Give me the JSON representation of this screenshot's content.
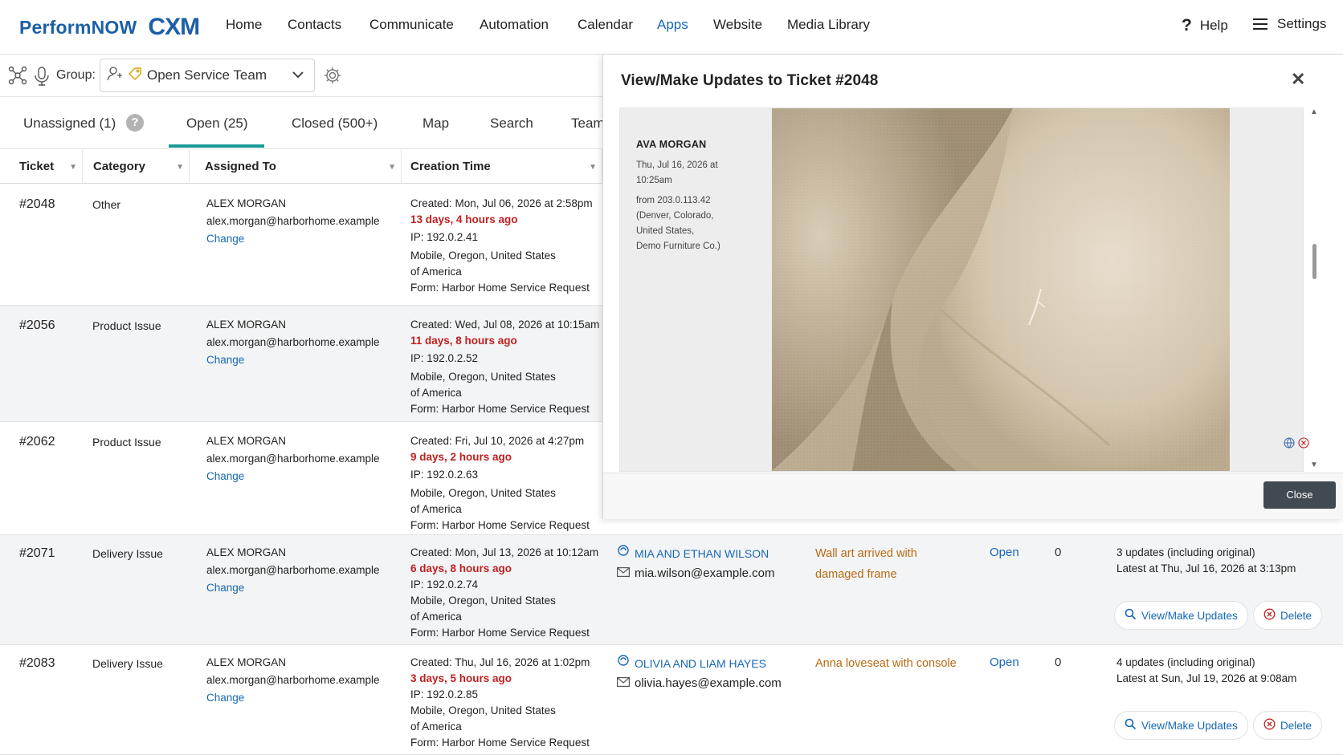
{
  "nav": {
    "logo_text": "PerformNOW",
    "logo_mark": "CXM",
    "items": [
      "Home",
      "Contacts",
      "Communicate",
      "Automation",
      "Calendar",
      "Apps",
      "Website",
      "Media Library"
    ],
    "active": "Apps",
    "help": "Help",
    "help_icon": "?",
    "settings": "Settings"
  },
  "toolbar": {
    "group_label": "Group:",
    "group_value": "Open Service Team"
  },
  "tabs": {
    "unassigned": "Unassigned (1)",
    "open": "Open (25)",
    "closed": "Closed (500+)",
    "map": "Map",
    "search": "Search",
    "team": "Team",
    "help_bubble": "?"
  },
  "columns": {
    "ticket": "Ticket",
    "category": "Category",
    "assigned": "Assigned To",
    "created": "Creation Time"
  },
  "rows": [
    {
      "ticket": "#2048",
      "category": "Other",
      "assignee": "ALEX MORGAN",
      "assignee_email": "alex.morgan@harborhome.example",
      "change": "Change",
      "created": "Created: Mon, Jul 06, 2026 at 2:58pm",
      "ago": "13 days, 4 hours ago",
      "ip": "IP: 192.0.2.41",
      "loc1": "Mobile, Oregon, United States",
      "loc2": "of America",
      "form": "Form: Harbor Home Service Request"
    },
    {
      "ticket": "#2056",
      "category": "Product Issue",
      "assignee": "ALEX MORGAN",
      "assignee_email": "alex.morgan@harborhome.example",
      "change": "Change",
      "created": "Created: Wed, Jul 08, 2026 at 10:15am",
      "ago": "11 days, 8 hours ago",
      "ip": "IP: 192.0.2.52",
      "loc1": "Mobile, Oregon, United States",
      "loc2": "of America",
      "form": "Form: Harbor Home Service Request"
    },
    {
      "ticket": "#2062",
      "category": "Product Issue",
      "assignee": "ALEX MORGAN",
      "assignee_email": "alex.morgan@harborhome.example",
      "change": "Change",
      "created": "Created: Fri, Jul 10, 2026 at 4:27pm",
      "ago": "9 days, 2 hours ago",
      "ip": "IP: 192.0.2.63",
      "loc1": "Mobile, Oregon, United States",
      "loc2": "of America",
      "form": "Form: Harbor Home Service Request"
    },
    {
      "ticket": "#2071",
      "category": "Delivery Issue",
      "assignee": "ALEX MORGAN",
      "assignee_email": "alex.morgan@harborhome.example",
      "change": "Change",
      "created": "Created: Mon, Jul 13, 2026 at 10:12am",
      "ago": "6 days, 8 hours ago",
      "ip": "IP: 192.0.2.74",
      "loc1": "Mobile, Oregon, United States",
      "loc2": "of America",
      "form": "Form: Harbor Home Service Request",
      "customer": "MIA AND ETHAN WILSON",
      "customer_email": "mia.wilson@example.com",
      "subject1": "Wall art arrived with",
      "subject2": "damaged frame",
      "status": "Open",
      "count": "0",
      "updates": "3 updates (including original)",
      "latest": "Latest at Thu, Jul 16, 2026 at 3:13pm",
      "view_btn": "View/Make Updates",
      "delete_btn": "Delete"
    },
    {
      "ticket": "#2083",
      "category": "Delivery Issue",
      "assignee": "ALEX MORGAN",
      "assignee_email": "alex.morgan@harborhome.example",
      "change": "Change",
      "created": "Created: Thu, Jul 16, 2026 at 1:02pm",
      "ago": "3 days, 5 hours ago",
      "ip": "IP: 192.0.2.85",
      "loc1": "Mobile, Oregon, United States",
      "loc2": "of America",
      "form": "Form: Harbor Home Service Request",
      "customer": "OLIVIA AND LIAM HAYES",
      "customer_email": "olivia.hayes@example.com",
      "subject1": "Anna loveseat with console",
      "status": "Open",
      "count": "0",
      "updates": "4 updates (including original)",
      "latest": "Latest at Sun, Jul 19, 2026 at 9:08am",
      "view_btn": "View/Make Updates",
      "delete_btn": "Delete"
    }
  ],
  "modal": {
    "title": "View/Make Updates to Ticket #2048",
    "close_x": "✕",
    "author": "AVA MORGAN",
    "date1": "Thu, Jul 16, 2026 at",
    "date2": "10:25am",
    "from1": "from 203.0.113.42",
    "from2": "(Denver, Colorado,",
    "from3": "United States,",
    "from4": "Demo Furniture Co.)",
    "close_btn": "Close"
  },
  "colors": {
    "brand": "#1c5fa8",
    "link": "#1667b8",
    "tab_underline": "#1a9a96",
    "overdue": "#c0201f",
    "subject": "#b96a12",
    "close_button": "#414a51"
  }
}
